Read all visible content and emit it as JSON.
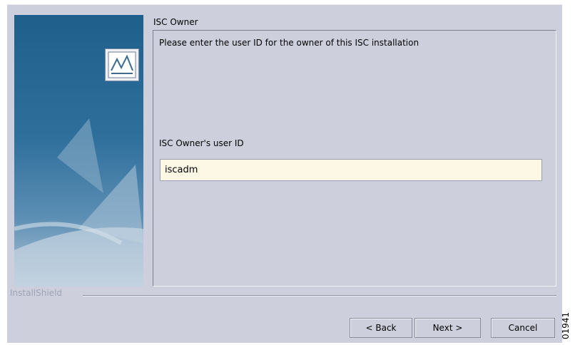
{
  "dialog": {
    "step_title": "ISC Owner",
    "prompt": "Please enter the user ID for the owner of this ISC installation",
    "field_label": "ISC Owner's user ID",
    "userid_value": "iscadm",
    "brand": "InstallShield"
  },
  "buttons": {
    "back": "< Back",
    "next": "Next >",
    "cancel": "Cancel"
  },
  "figure_number": "01941",
  "colors": {
    "dialog_bg": "#cdd0dc",
    "input_bg": "#fdf8e5",
    "side_panel": "#2e6f9c"
  }
}
